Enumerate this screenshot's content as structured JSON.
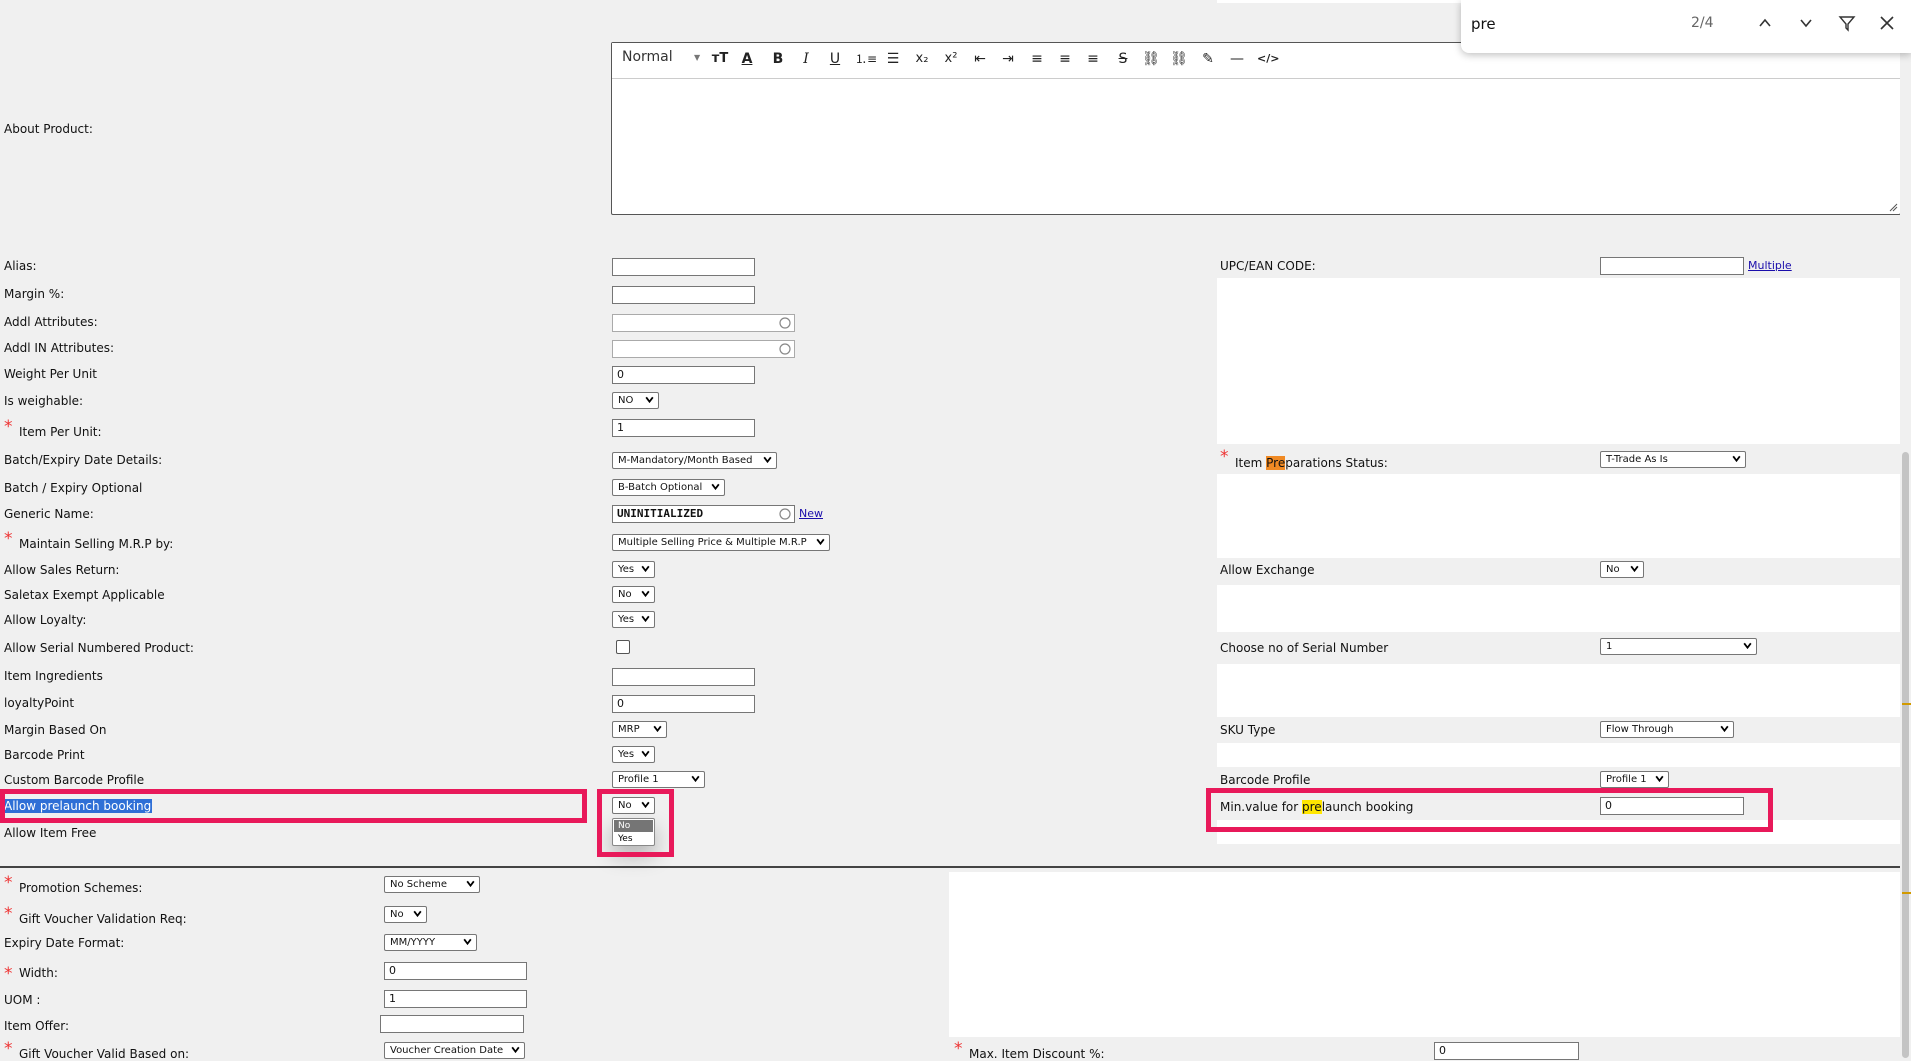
{
  "find_bar": {
    "query": "pre",
    "count": "2/4"
  },
  "editor": {
    "label": "About Product:",
    "format_value": "Normal"
  },
  "left_fields": [
    {
      "label": "Alias:"
    },
    {
      "label": "Margin %:"
    },
    {
      "label": "Addl Attributes:"
    },
    {
      "label": "Addl IN Attributes:"
    },
    {
      "label": "Weight Per Unit",
      "value": "0"
    },
    {
      "label": "Is weighable:",
      "value": "NO"
    },
    {
      "label": "Item Per Unit:",
      "value": "1"
    },
    {
      "label": "Batch/Expiry Date Details:",
      "value": "M-Mandatory/Month Based"
    },
    {
      "label": "Batch / Expiry Optional",
      "value": "B-Batch Optional"
    },
    {
      "label": "Generic Name:",
      "value": "UNINITIALIZED",
      "link": "New"
    },
    {
      "label": "Maintain Selling M.R.P by:",
      "value": "Multiple Selling Price & Multiple M.R.P"
    },
    {
      "label": "Allow Sales Return:",
      "value": "Yes"
    },
    {
      "label": "Saletax Exempt Applicable",
      "value": "No"
    },
    {
      "label": "Allow Loyalty:",
      "value": "Yes"
    },
    {
      "label": "Allow Serial Numbered Product:"
    },
    {
      "label": "Item Ingredients"
    },
    {
      "label": "loyaltyPoint",
      "value": "0"
    },
    {
      "label": "Margin Based On",
      "value": "MRP"
    },
    {
      "label": "Barcode Print",
      "value": "Yes"
    },
    {
      "label": "Custom Barcode Profile",
      "value": "Profile 1"
    },
    {
      "label": "Allow prelaunch booking",
      "value": "No"
    },
    {
      "label": "Allow Item Free"
    }
  ],
  "prelaunch_dropdown": {
    "options": [
      "No",
      "Yes"
    ]
  },
  "right_fields": [
    {
      "label": "UPC/EAN CODE:",
      "link": "Multiple"
    },
    {
      "label_prefix": "Item ",
      "label_hl": "Pre",
      "label_suffix": "parations Status:",
      "value": "T-Trade As Is"
    },
    {
      "label": "Allow Exchange",
      "value": "No"
    },
    {
      "label": "Choose no of Serial Number",
      "value": "1"
    },
    {
      "label": "SKU Type",
      "value": "Flow Through"
    },
    {
      "label": "Barcode Profile",
      "value": "Profile 1"
    },
    {
      "label_prefix": "Min.value for ",
      "label_hl": "pre",
      "label_suffix": "launch booking",
      "value": "0"
    }
  ],
  "lower_fields": [
    {
      "label": "Promotion Schemes:",
      "value": "No Scheme"
    },
    {
      "label": "Gift Voucher Validation Req:",
      "value": "No"
    },
    {
      "label": "Expiry Date Format:",
      "value": "MM/YYYY"
    },
    {
      "label": "Width:",
      "value": "0"
    },
    {
      "label": "UOM :",
      "value": "1"
    },
    {
      "label": "Item Offer:"
    },
    {
      "label": "Gift Voucher Valid Based on:",
      "value": "Voucher Creation Date"
    },
    {
      "label": "Max. Item Discount %:",
      "value": "0"
    }
  ],
  "colors": {
    "accent_red": "#e8195a",
    "required": "#ee3333",
    "find_highlight_active": "#f08a24",
    "find_highlight": "#ffe600"
  }
}
